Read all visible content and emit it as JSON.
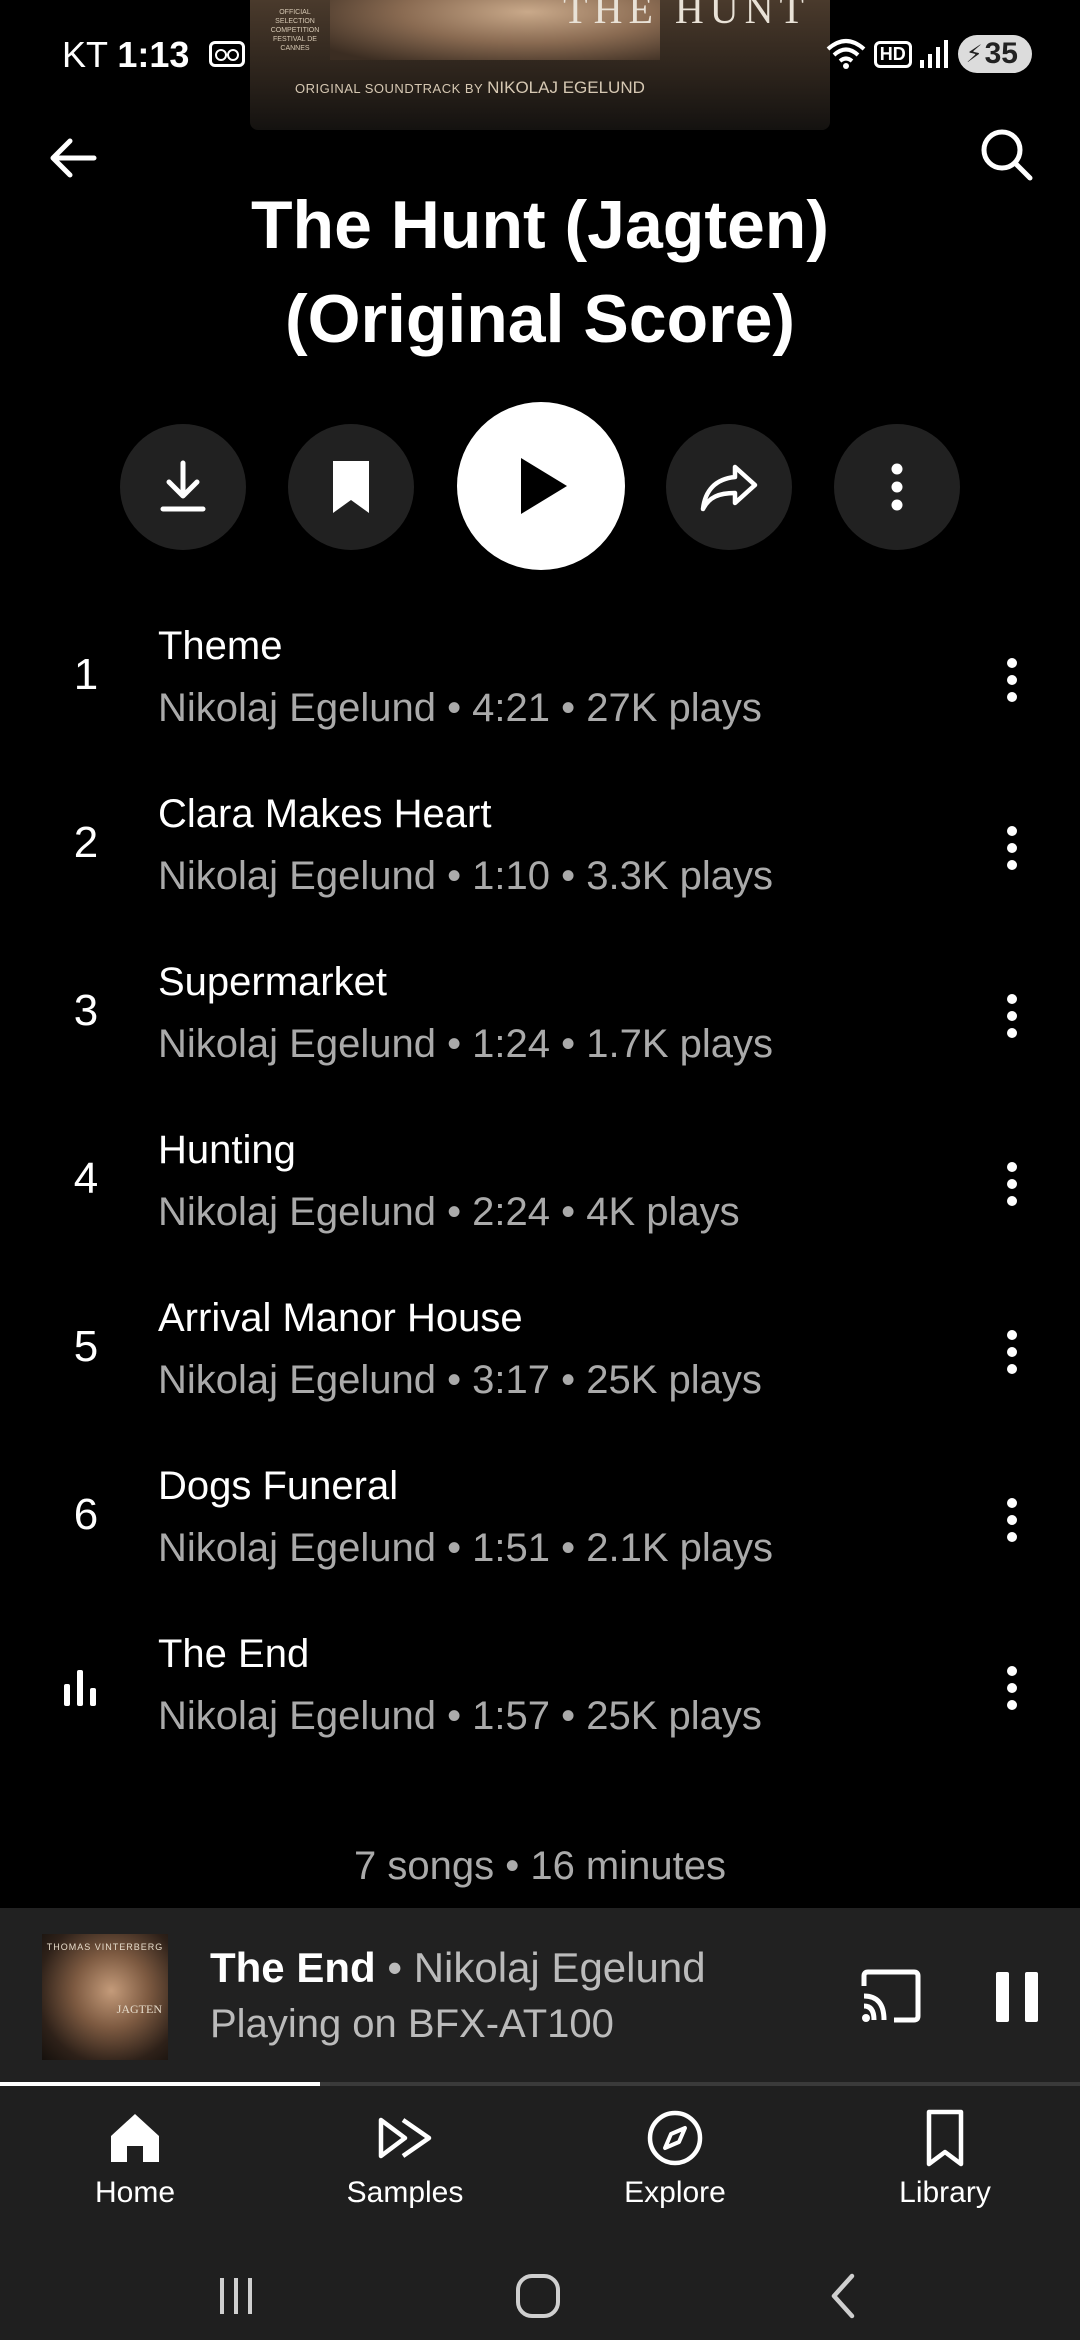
{
  "album_art": {
    "header_text": "THE HUNT",
    "credit_prefix": "ORIGINAL SOUNDTRACK BY",
    "credit_name": "NIKOLAJ EGELUND",
    "badge_text": "OFFICIAL SELECTION COMPETITION FESTIVAL DE CANNES"
  },
  "status_bar": {
    "carrier": "KT",
    "time": "1:13",
    "hd_label": "HD",
    "battery": "35"
  },
  "header": {
    "title_line1": "The Hunt (Jagten)",
    "title_line2": "(Original Score)",
    "back_icon": "arrow-left-icon",
    "search_icon": "search-icon"
  },
  "actions": [
    {
      "name": "download",
      "icon": "download-icon"
    },
    {
      "name": "save",
      "icon": "bookmark-icon"
    },
    {
      "name": "play",
      "icon": "play-icon"
    },
    {
      "name": "share",
      "icon": "share-icon"
    },
    {
      "name": "more",
      "icon": "more-vert-icon"
    }
  ],
  "tracks": [
    {
      "num": "1",
      "title": "Theme",
      "meta": "Nikolaj Egelund • 4:21 • 27K plays",
      "playing": false
    },
    {
      "num": "2",
      "title": "Clara Makes Heart",
      "meta": "Nikolaj Egelund • 1:10 • 3.3K plays",
      "playing": false
    },
    {
      "num": "3",
      "title": "Supermarket",
      "meta": "Nikolaj Egelund • 1:24 • 1.7K plays",
      "playing": false
    },
    {
      "num": "4",
      "title": "Hunting",
      "meta": "Nikolaj Egelund • 2:24 • 4K plays",
      "playing": false
    },
    {
      "num": "5",
      "title": "Arrival Manor House",
      "meta": "Nikolaj Egelund • 3:17 • 25K plays",
      "playing": false
    },
    {
      "num": "6",
      "title": "Dogs Funeral",
      "meta": "Nikolaj Egelund • 1:51 • 2.1K plays",
      "playing": false
    },
    {
      "num": "",
      "title": "The End",
      "meta": "Nikolaj Egelund • 1:57 • 25K plays",
      "playing": true
    }
  ],
  "summary": "7 songs • 16 minutes",
  "mini_player": {
    "song": "The End",
    "separator": " • ",
    "artist": "Nikolaj Egelund",
    "subtitle": "Playing on BFX-AT100",
    "art_top_text": "THOMAS VINTERBERG",
    "art_title_text": "JAGTEN",
    "progress_fraction": 0.296
  },
  "bottom_nav": [
    {
      "label": "Home",
      "icon": "home-icon",
      "active": true
    },
    {
      "label": "Samples",
      "icon": "samples-icon",
      "active": false
    },
    {
      "label": "Explore",
      "icon": "explore-icon",
      "active": false
    },
    {
      "label": "Library",
      "icon": "library-icon",
      "active": false
    }
  ],
  "colors": {
    "background": "#000000",
    "surface": "#212121",
    "secondary_text": "#aaaaaa",
    "accent": "#ffffff"
  }
}
